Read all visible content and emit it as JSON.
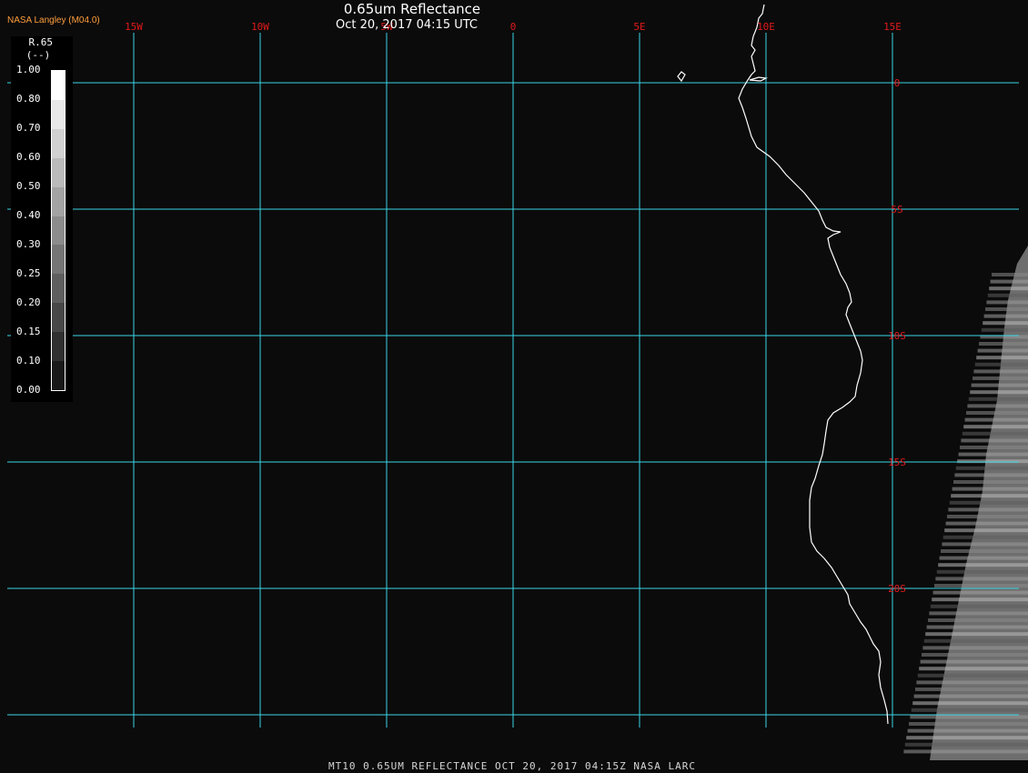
{
  "header": {
    "title": "0.65um Reflectance",
    "datetime": "Oct 20, 2017 04:15 UTC",
    "brand": "NASA Langley (M04.0)"
  },
  "footer": {
    "caption": "MT10  0.65UM REFLECTANCE   OCT 20, 2017 04:15Z   NASA LARC"
  },
  "legend": {
    "name": "R.65",
    "unit": "(--)",
    "ticks": [
      "1.00",
      "0.80",
      "0.70",
      "0.60",
      "0.50",
      "0.40",
      "0.30",
      "0.25",
      "0.20",
      "0.15",
      "0.10",
      "0.00"
    ]
  },
  "grid": {
    "longitude_labels": [
      "15W",
      "10W",
      "5W",
      "0",
      "5E",
      "10E",
      "15E"
    ],
    "latitude_labels": [
      "0",
      "5S",
      "10S",
      "15S",
      "20S"
    ],
    "longitudes_deg": [
      -15,
      -10,
      -5,
      0,
      5,
      10,
      15
    ],
    "latitudes_deg": [
      0,
      -5,
      -10,
      -15,
      -20,
      -25
    ],
    "line_color": "#39d5e6",
    "label_color": "#e0191b"
  },
  "colors": {
    "background": "#0b0b0b",
    "coastline": "#ffffff",
    "brand_color": "#ff9e3d"
  }
}
